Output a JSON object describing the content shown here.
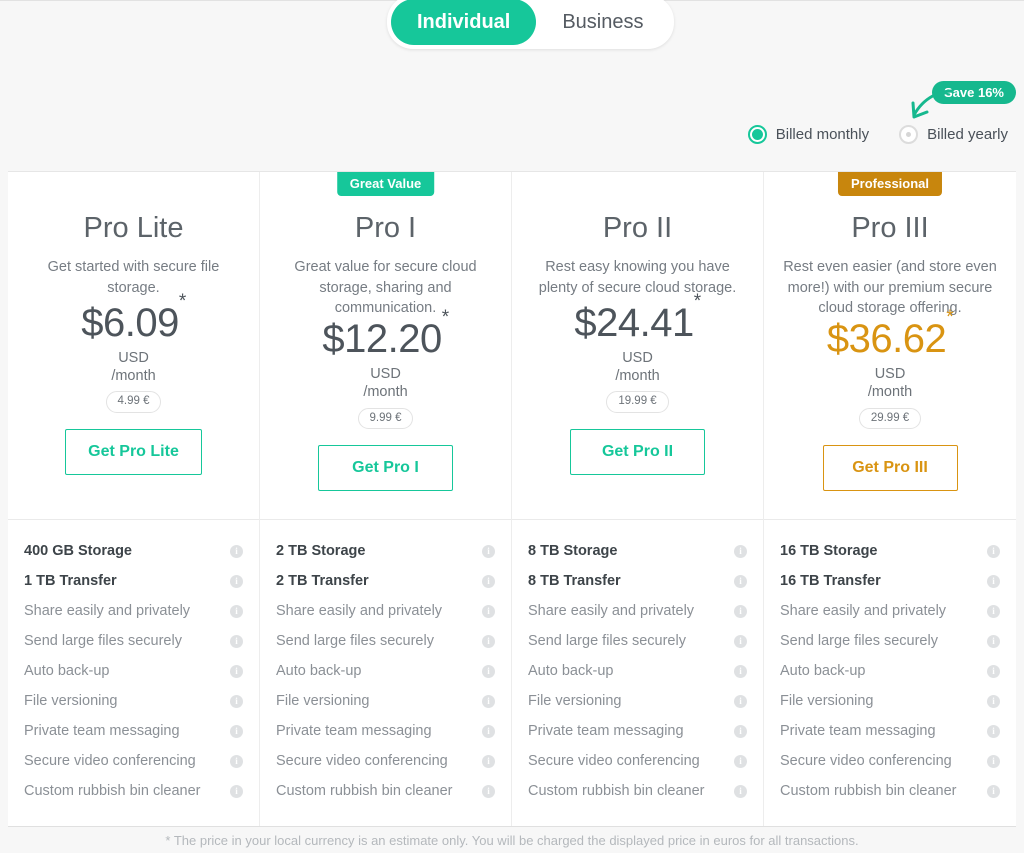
{
  "audience_toggle": {
    "options": [
      {
        "label": "Individual",
        "active": true
      },
      {
        "label": "Business",
        "active": false
      }
    ]
  },
  "promo": {
    "save_badge": "Save 16%"
  },
  "billing_cycle": {
    "options": [
      {
        "label": "Billed monthly",
        "selected": true
      },
      {
        "label": "Billed yearly",
        "selected": false
      }
    ]
  },
  "colors": {
    "teal": "#16c79a",
    "teal_badge": "#16b88e",
    "gold": "#d99412",
    "gold_badge": "#c8860d",
    "page_bg": "#f7f7f7",
    "card_bg": "#ffffff"
  },
  "plans": [
    {
      "ribbon": null,
      "name": "Pro Lite",
      "description": "Get started with secure file storage.",
      "price": "$6.09",
      "price_asterisk": "*",
      "currency": "USD",
      "period": "/month",
      "euro_price": "4.99 €",
      "cta": "Get Pro Lite",
      "accent": "teal",
      "features": [
        {
          "label": "400 GB Storage",
          "strong": true
        },
        {
          "label": "1 TB Transfer",
          "strong": true
        },
        {
          "label": "Share easily and privately",
          "strong": false
        },
        {
          "label": "Send large files securely",
          "strong": false
        },
        {
          "label": "Auto back-up",
          "strong": false
        },
        {
          "label": "File versioning",
          "strong": false
        },
        {
          "label": "Private team messaging",
          "strong": false
        },
        {
          "label": "Secure video conferencing",
          "strong": false
        },
        {
          "label": "Custom rubbish bin cleaner",
          "strong": false
        }
      ]
    },
    {
      "ribbon": "Great Value",
      "ribbon_style": "teal",
      "name": "Pro I",
      "description": "Great value for secure cloud storage, sharing and communication.",
      "price": "$12.20",
      "price_asterisk": "*",
      "currency": "USD",
      "period": "/month",
      "euro_price": "9.99 €",
      "cta": "Get Pro I",
      "accent": "teal",
      "features": [
        {
          "label": "2 TB Storage",
          "strong": true
        },
        {
          "label": "2 TB Transfer",
          "strong": true
        },
        {
          "label": "Share easily and privately",
          "strong": false
        },
        {
          "label": "Send large files securely",
          "strong": false
        },
        {
          "label": "Auto back-up",
          "strong": false
        },
        {
          "label": "File versioning",
          "strong": false
        },
        {
          "label": "Private team messaging",
          "strong": false
        },
        {
          "label": "Secure video conferencing",
          "strong": false
        },
        {
          "label": "Custom rubbish bin cleaner",
          "strong": false
        }
      ]
    },
    {
      "ribbon": null,
      "name": "Pro II",
      "description": "Rest easy knowing you have plenty of secure cloud storage.",
      "price": "$24.41",
      "price_asterisk": "*",
      "currency": "USD",
      "period": "/month",
      "euro_price": "19.99 €",
      "cta": "Get Pro II",
      "accent": "teal",
      "features": [
        {
          "label": "8 TB Storage",
          "strong": true
        },
        {
          "label": "8 TB Transfer",
          "strong": true
        },
        {
          "label": "Share easily and privately",
          "strong": false
        },
        {
          "label": "Send large files securely",
          "strong": false
        },
        {
          "label": "Auto back-up",
          "strong": false
        },
        {
          "label": "File versioning",
          "strong": false
        },
        {
          "label": "Private team messaging",
          "strong": false
        },
        {
          "label": "Secure video conferencing",
          "strong": false
        },
        {
          "label": "Custom rubbish bin cleaner",
          "strong": false
        }
      ]
    },
    {
      "ribbon": "Professional",
      "ribbon_style": "gold",
      "name": "Pro III",
      "description": "Rest even easier (and store even more!) with our premium secure cloud storage offering.",
      "price": "$36.62",
      "price_asterisk": "*",
      "currency": "USD",
      "period": "/month",
      "euro_price": "29.99 €",
      "cta": "Get Pro III",
      "accent": "gold",
      "features": [
        {
          "label": "16 TB Storage",
          "strong": true
        },
        {
          "label": "16 TB Transfer",
          "strong": true
        },
        {
          "label": "Share easily and privately",
          "strong": false
        },
        {
          "label": "Send large files securely",
          "strong": false
        },
        {
          "label": "Auto back-up",
          "strong": false
        },
        {
          "label": "File versioning",
          "strong": false
        },
        {
          "label": "Private team messaging",
          "strong": false
        },
        {
          "label": "Secure video conferencing",
          "strong": false
        },
        {
          "label": "Custom rubbish bin cleaner",
          "strong": false
        }
      ]
    }
  ],
  "info_icon_glyph": "i",
  "footnote": "* The price in your local currency is an estimate only. You will be charged the displayed price in euros for all transactions."
}
